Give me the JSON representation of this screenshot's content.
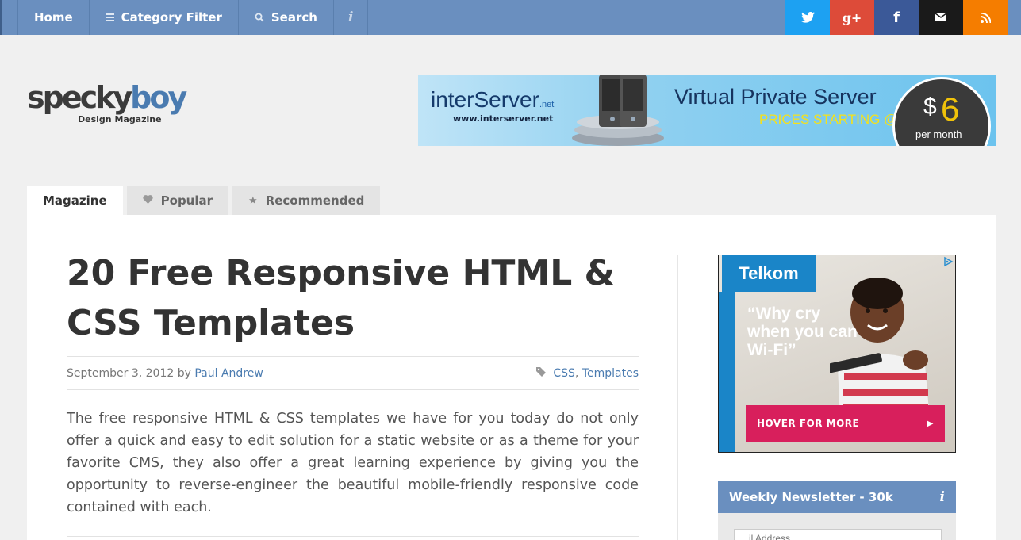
{
  "nav": {
    "items": [
      {
        "label": "Home",
        "icon": ""
      },
      {
        "label": "Category Filter",
        "icon": "menu-icon"
      },
      {
        "label": "Search",
        "icon": "search-icon"
      }
    ],
    "info_label": "i"
  },
  "social": [
    {
      "name": "twitter",
      "glyph": "t",
      "color": "#1da1f2"
    },
    {
      "name": "google-plus",
      "glyph": "g+",
      "color": "#dd4b39"
    },
    {
      "name": "facebook",
      "glyph": "f",
      "color": "#3b5998"
    },
    {
      "name": "email",
      "glyph": "✉",
      "color": "#1a1a1a"
    },
    {
      "name": "rss",
      "glyph": "◠",
      "color": "#f57d00"
    }
  ],
  "logo": {
    "word_a": "specky",
    "word_b": "boy",
    "tagline": "Design Magazine"
  },
  "banner": {
    "brand": "interServer",
    "brand_suffix": ".net",
    "url": "www.interserver.net",
    "headline": "Virtual Private Server",
    "subline": "PRICES STARTING @",
    "currency": "$",
    "price": "6",
    "period": "per month"
  },
  "tabs": [
    {
      "label": "Magazine",
      "icon": "",
      "active": true
    },
    {
      "label": "Popular",
      "icon": "heart-icon",
      "active": false
    },
    {
      "label": "Recommended",
      "icon": "star-icon",
      "active": false
    }
  ],
  "article": {
    "title": "20 Free Responsive HTML & CSS Templates",
    "date": "September 3, 2012",
    "by": "by",
    "author": "Paul Andrew",
    "tag_1": "CSS",
    "tag_sep": ",",
    "tag_2": "Templates",
    "excerpt": "The free responsive HTML & CSS templates we have for you today do not only offer a quick and easy to edit solution for a static website or as a theme for your favorite CMS, they also offer a great learning experience by giving you the opportunity to reverse-engineer the beautiful mobile-friendly responsive code contained with each."
  },
  "sidebar_ad": {
    "brand": "Telkom",
    "quote": "“Why cry when you can Wi-Fi”",
    "cta": "HOVER FOR MORE",
    "cta_arrow": "▶"
  },
  "newsletter": {
    "title": "Weekly Newsletter - 30k",
    "info_label": "i",
    "input_placeholder": "...il Address"
  }
}
